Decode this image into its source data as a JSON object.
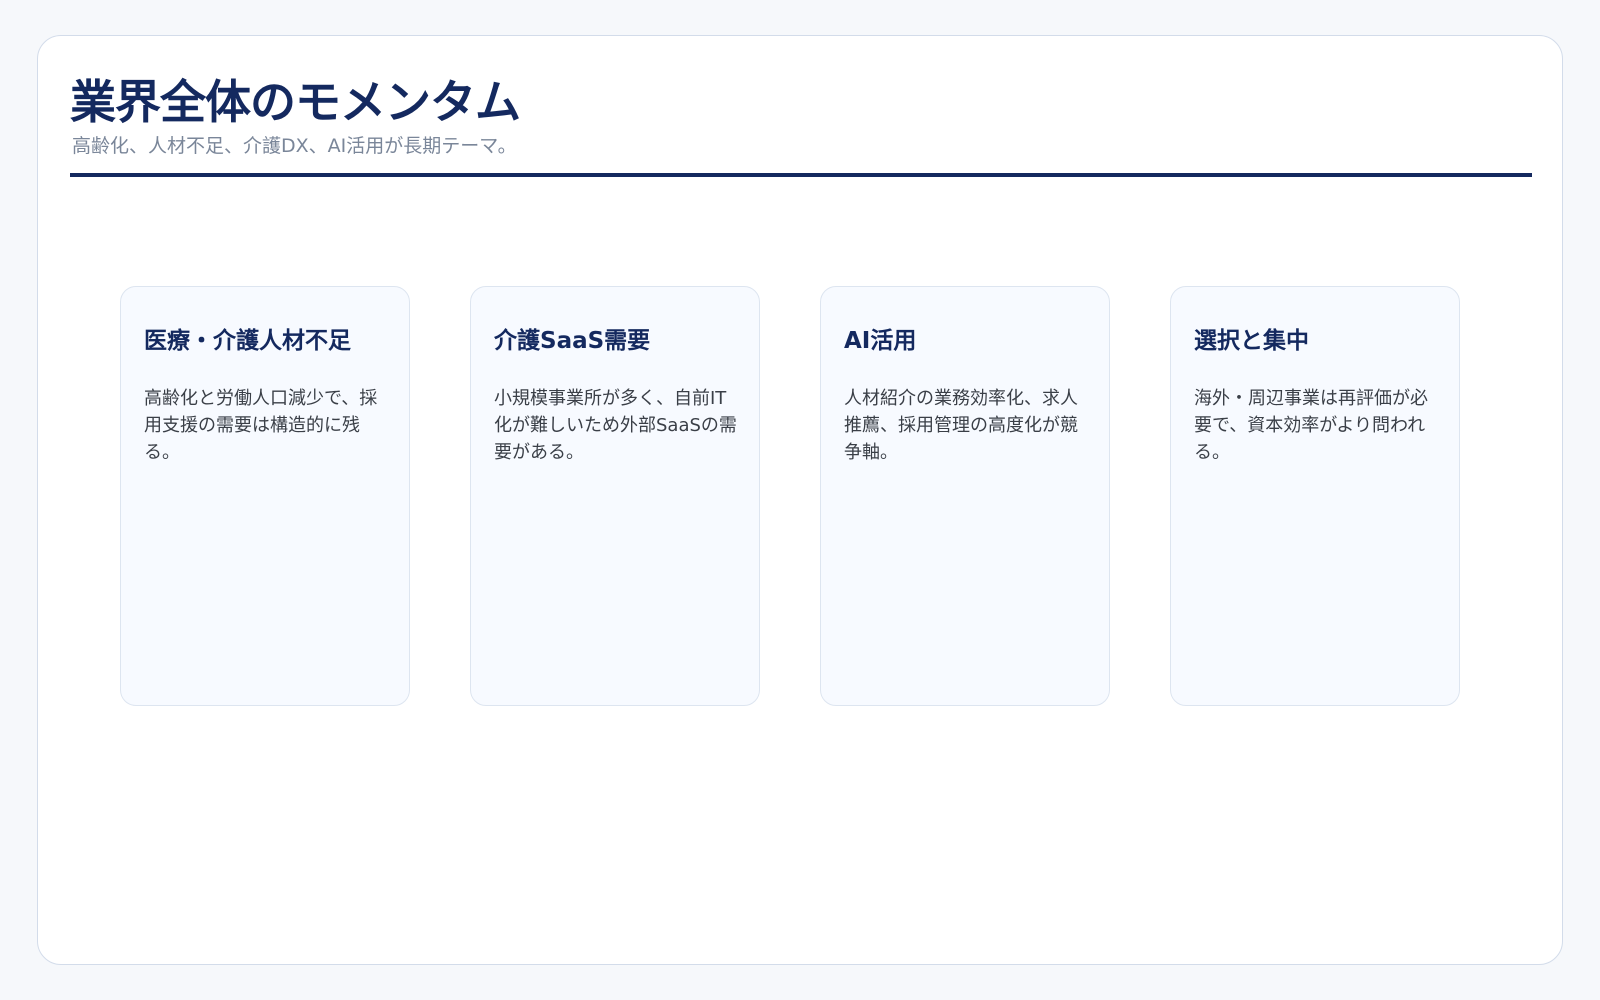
{
  "header": {
    "title": "業界全体のモメンタム",
    "subtitle": "高齢化、人材不足、介護DX、AI活用が長期テーマ。"
  },
  "cards": [
    {
      "title": "医療・介護人材不足",
      "text": "高齢化と労働人口減少で、採用支援の需要は構造的に残る。"
    },
    {
      "title": "介護SaaS需要",
      "text": "小規模事業所が多く、自前IT化が難しいため外部SaaSの需要がある。"
    },
    {
      "title": "AI活用",
      "text": "人材紹介の業務効率化、求人推薦、採用管理の高度化が競争軸。"
    },
    {
      "title": "選択と集中",
      "text": "海外・周辺事業は再評価が必要で、資本効率がより問われる。"
    }
  ],
  "colors": {
    "accent": "#14295f",
    "subtitle": "#7a8699",
    "card_bg": "#f7faff",
    "card_border": "#dde5f0",
    "page_bg": "#f6f8fb"
  }
}
